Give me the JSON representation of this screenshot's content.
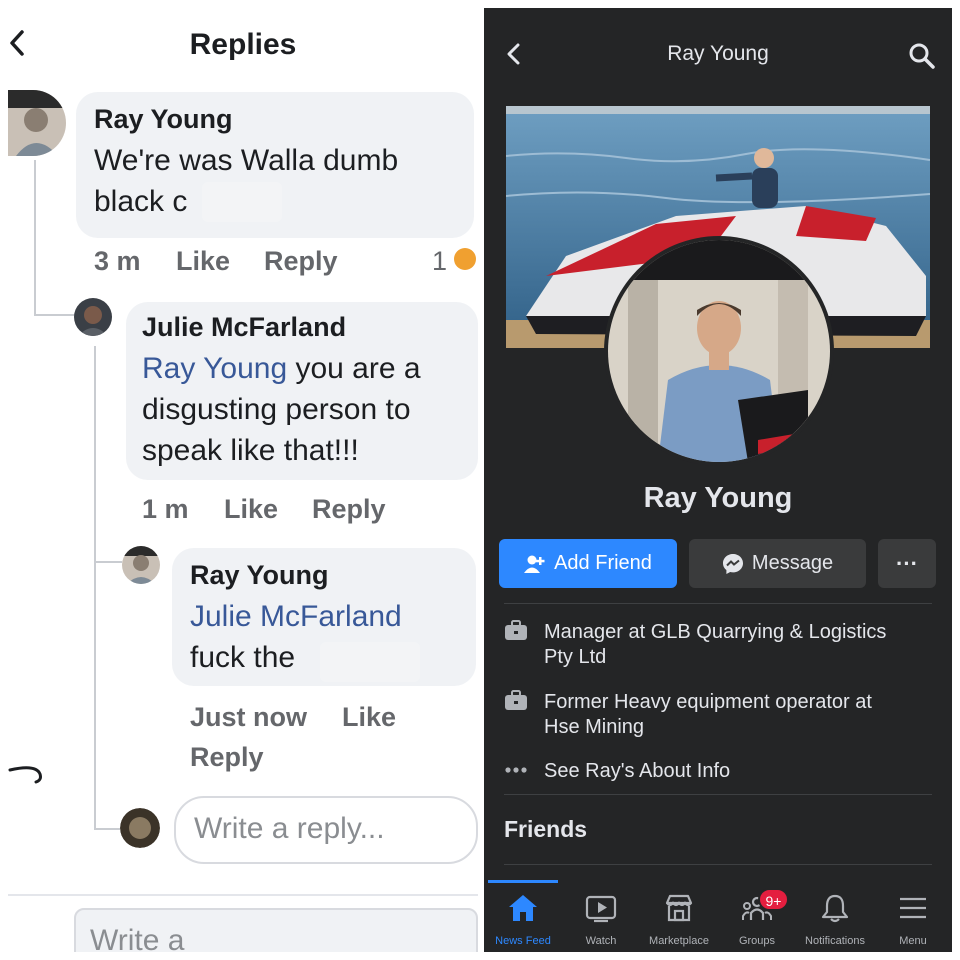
{
  "left_panel": {
    "title": "Replies",
    "comments": [
      {
        "author": "Ray Young",
        "text_line1": "We're was Walla dumb",
        "text_line2": "black c",
        "time": "3 m",
        "like": "Like",
        "reply": "Reply",
        "reaction_count": "1"
      },
      {
        "author": "Julie McFarland",
        "mention": "Ray Young",
        "text_after_mention": " you are a",
        "text_line2": "disgusting person to",
        "text_line3": "speak like that!!!",
        "time": "1 m",
        "like": "Like",
        "reply": "Reply"
      },
      {
        "author": "Ray Young",
        "mention": "Julie McFarland",
        "text_line2": "fuck the",
        "time": "Just now",
        "like": "Like",
        "reply": "Reply"
      }
    ],
    "write_reply_placeholder": "Write a reply...",
    "write_comment_placeholder": "Write a"
  },
  "right_panel": {
    "header_title": "Ray Young",
    "profile_name": "Ray Young",
    "buttons": {
      "add_friend": "Add Friend",
      "message": "Message",
      "more": "···"
    },
    "about": [
      {
        "icon": "briefcase-icon",
        "text_line1": "Manager at GLB Quarrying & Logistics",
        "text_line2": "Pty Ltd"
      },
      {
        "icon": "briefcase-icon",
        "text_line1": "Former Heavy equipment operator at",
        "text_line2": "Hse Mining"
      },
      {
        "icon": "ellipsis-icon",
        "text_line1": "See Ray's About Info"
      }
    ],
    "friends_heading": "Friends",
    "tabs": [
      {
        "label": "News Feed",
        "icon": "home-icon",
        "active": true
      },
      {
        "label": "Watch",
        "icon": "watch-icon"
      },
      {
        "label": "Marketplace",
        "icon": "marketplace-icon"
      },
      {
        "label": "Groups",
        "icon": "groups-icon",
        "badge": "9+"
      },
      {
        "label": "Notifications",
        "icon": "bell-icon"
      },
      {
        "label": "Menu",
        "icon": "menu-icon"
      }
    ],
    "accent_color": "#2d88ff",
    "badge_color": "#e41e3f"
  }
}
